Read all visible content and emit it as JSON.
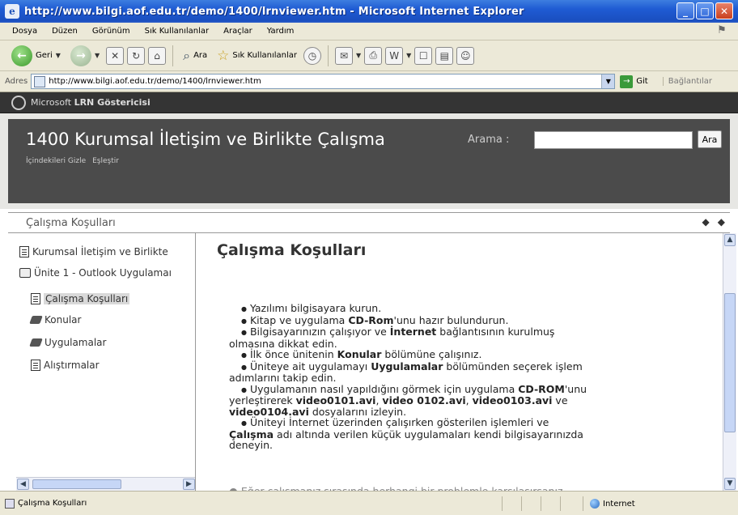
{
  "window": {
    "title": "http://www.bilgi.aof.edu.tr/demo/1400/lrnviewer.htm - Microsoft Internet Explorer",
    "controls": [
      "minimize",
      "maximize",
      "close"
    ]
  },
  "menu": {
    "items": [
      "Dosya",
      "Düzen",
      "Görünüm",
      "Sık Kullanılanlar",
      "Araçlar",
      "Yardım"
    ]
  },
  "toolbar": {
    "back_label": "Geri",
    "search_label": "Ara",
    "favorites_label": "Sık Kullanılanlar"
  },
  "address": {
    "label": "Adres",
    "url": "http://www.bilgi.aof.edu.tr/demo/1400/lrnviewer.htm",
    "go_label": "Git",
    "links_label": "Bağlantılar"
  },
  "lrn": {
    "viewer_prefix": "Microsoft",
    "viewer_name": "LRN Göstericisi",
    "course_title": "1400 Kurumsal İletişim ve Birlikte Çalışma",
    "hide_toc": "İçindekileri Gizle",
    "sync": "Eşleştir",
    "search_label": "Arama :",
    "search_value": "",
    "search_button": "Ara",
    "breadcrumb": "Çalışma Koşulları"
  },
  "sidebar": {
    "items": [
      {
        "label": "Kurumsal İletişim ve Birlikte",
        "icon": "page-icon"
      },
      {
        "label": "Ünite 1 - Outlook Uygulamaı",
        "icon": "book-icon"
      },
      {
        "label": "Çalışma Koşulları",
        "icon": "page-icon",
        "selected": true
      },
      {
        "label": "Konular",
        "icon": "diamond-book-icon"
      },
      {
        "label": "Uygulamalar",
        "icon": "diamond-book-icon"
      },
      {
        "label": "Alıştırmalar",
        "icon": "page-icon"
      }
    ]
  },
  "content": {
    "heading": "Çalışma Koşulları",
    "lines": [
      {
        "bullet": true,
        "parts": [
          {
            "t": "Yazılımı bilgisayara kurun."
          }
        ]
      },
      {
        "bullet": true,
        "parts": [
          {
            "t": "Kitap ve uygulama "
          },
          {
            "t": "CD-Rom",
            "b": true
          },
          {
            "t": "'unu hazır bulundurun."
          }
        ]
      },
      {
        "bullet": true,
        "parts": [
          {
            "t": "Bilgisayarınızın çalışıyor ve "
          },
          {
            "t": "İnternet",
            "b": true
          },
          {
            "t": " bağlantısının kurulmuş"
          }
        ]
      },
      {
        "bullet": false,
        "parts": [
          {
            "t": "olmasına dikkat edin."
          }
        ]
      },
      {
        "bullet": true,
        "parts": [
          {
            "t": "İlk önce ünitenin "
          },
          {
            "t": "Konular",
            "b": true
          },
          {
            "t": " bölümüne çalışınız."
          }
        ]
      },
      {
        "bullet": true,
        "parts": [
          {
            "t": "Üniteye ait uygulamayı "
          },
          {
            "t": "Uygulamalar",
            "b": true
          },
          {
            "t": " bölümünden seçerek işlem"
          }
        ]
      },
      {
        "bullet": false,
        "parts": [
          {
            "t": "adımlarını takip edin."
          }
        ]
      },
      {
        "bullet": true,
        "parts": [
          {
            "t": "Uygulamanın nasıl yapıldığını görmek için uygulama "
          },
          {
            "t": "CD-ROM",
            "b": true
          },
          {
            "t": "'unu"
          }
        ]
      },
      {
        "bullet": false,
        "parts": [
          {
            "t": "yerleştirerek "
          },
          {
            "t": "video0101.avi",
            "b": true
          },
          {
            "t": ", "
          },
          {
            "t": "video 0102.avi",
            "b": true
          },
          {
            "t": ", "
          },
          {
            "t": "video0103.avi",
            "b": true
          },
          {
            "t": " ve"
          }
        ]
      },
      {
        "bullet": false,
        "parts": [
          {
            "t": "video0104.avi",
            "b": true
          },
          {
            "t": " dosyalarını izleyin."
          }
        ]
      },
      {
        "bullet": true,
        "parts": [
          {
            "t": "Üniteyi İnternet üzerinden çalışırken gösterilen işlemleri ve"
          }
        ]
      },
      {
        "bullet": false,
        "parts": [
          {
            "t": "Çalışma",
            "b": true
          },
          {
            "t": " adı altında verilen küçük uygulamaları kendi bilgisayarınızda"
          }
        ]
      },
      {
        "bullet": false,
        "parts": [
          {
            "t": "deneyin."
          }
        ]
      }
    ],
    "partial_line": "● Eğer çalışmanız sırasında herhangi bir problemle karşılaşırsanız"
  },
  "status": {
    "text": "Çalışma Koşulları",
    "zone": "Internet"
  }
}
